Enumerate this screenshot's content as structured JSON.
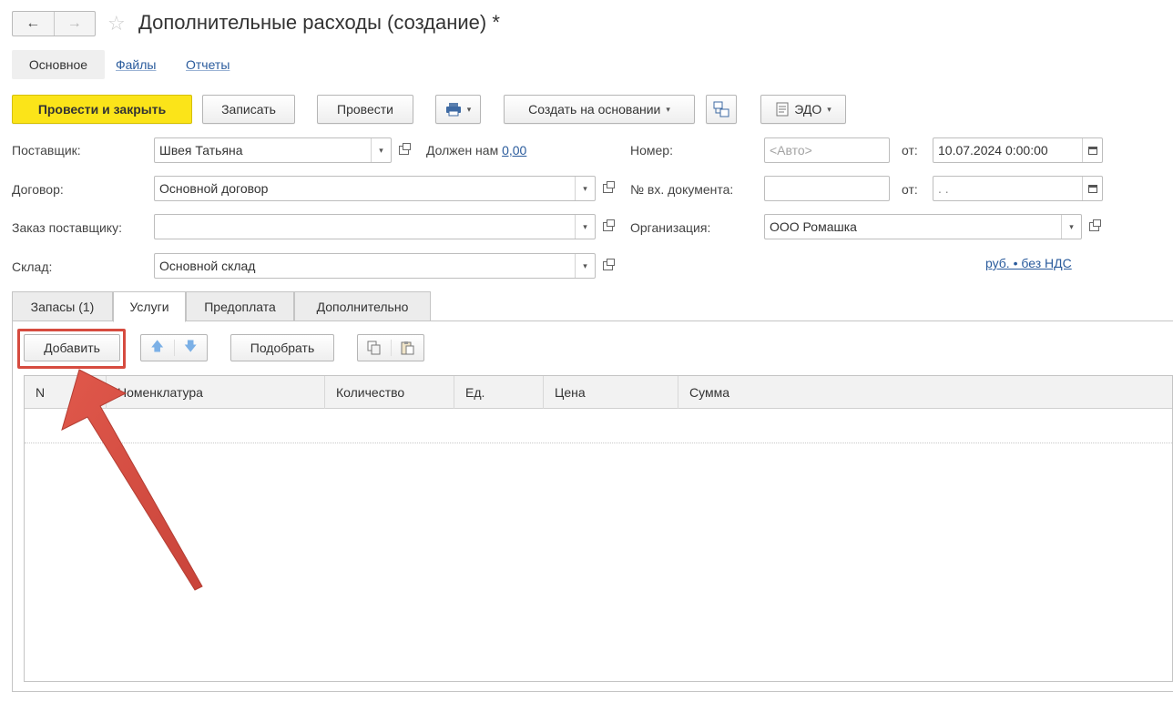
{
  "window": {
    "back_glyph": "←",
    "forward_glyph": "→",
    "title": "Дополнительные расходы (создание) *"
  },
  "sections": {
    "main": "Основное",
    "files": "Файлы",
    "reports": "Отчеты"
  },
  "toolbar": {
    "post_close": "Провести и закрыть",
    "save": "Записать",
    "post": "Провести",
    "create_based": "Создать на основании",
    "edo": "ЭДО"
  },
  "form": {
    "supplier_label": "Поставщик:",
    "supplier_value": "Швея Татьяна",
    "debt_text": "Должен нам",
    "debt_amount": "0,00",
    "contract_label": "Договор:",
    "contract_value": "Основной договор",
    "order_label": "Заказ поставщику:",
    "order_value": "",
    "warehouse_label": "Склад:",
    "warehouse_value": "Основной склад",
    "number_label": "Номер:",
    "number_placeholder": "<Авто>",
    "from_label": "от:",
    "date_value": "10.07.2024  0:00:00",
    "incoming_label": "№ вх. документа:",
    "incoming_value": "",
    "from_label2": "от:",
    "incoming_date_value": " .  .",
    "org_label": "Организация:",
    "org_value": "ООО Ромашка",
    "currency_link": "руб. • без НДС"
  },
  "tabs": [
    {
      "label": "Запасы (1)"
    },
    {
      "label": "Услуги"
    },
    {
      "label": "Предоплата"
    },
    {
      "label": "Дополнительно"
    }
  ],
  "services_toolbar": {
    "add": "Добавить",
    "pick": "Подобрать"
  },
  "table": {
    "columns": [
      "N",
      "Номенклатура",
      "Количество",
      "Ед.",
      "Цена",
      "Сумма"
    ]
  },
  "colors": {
    "primary_button": "#fbe419",
    "link": "#2a5b9c",
    "highlight": "#d64b3f"
  }
}
